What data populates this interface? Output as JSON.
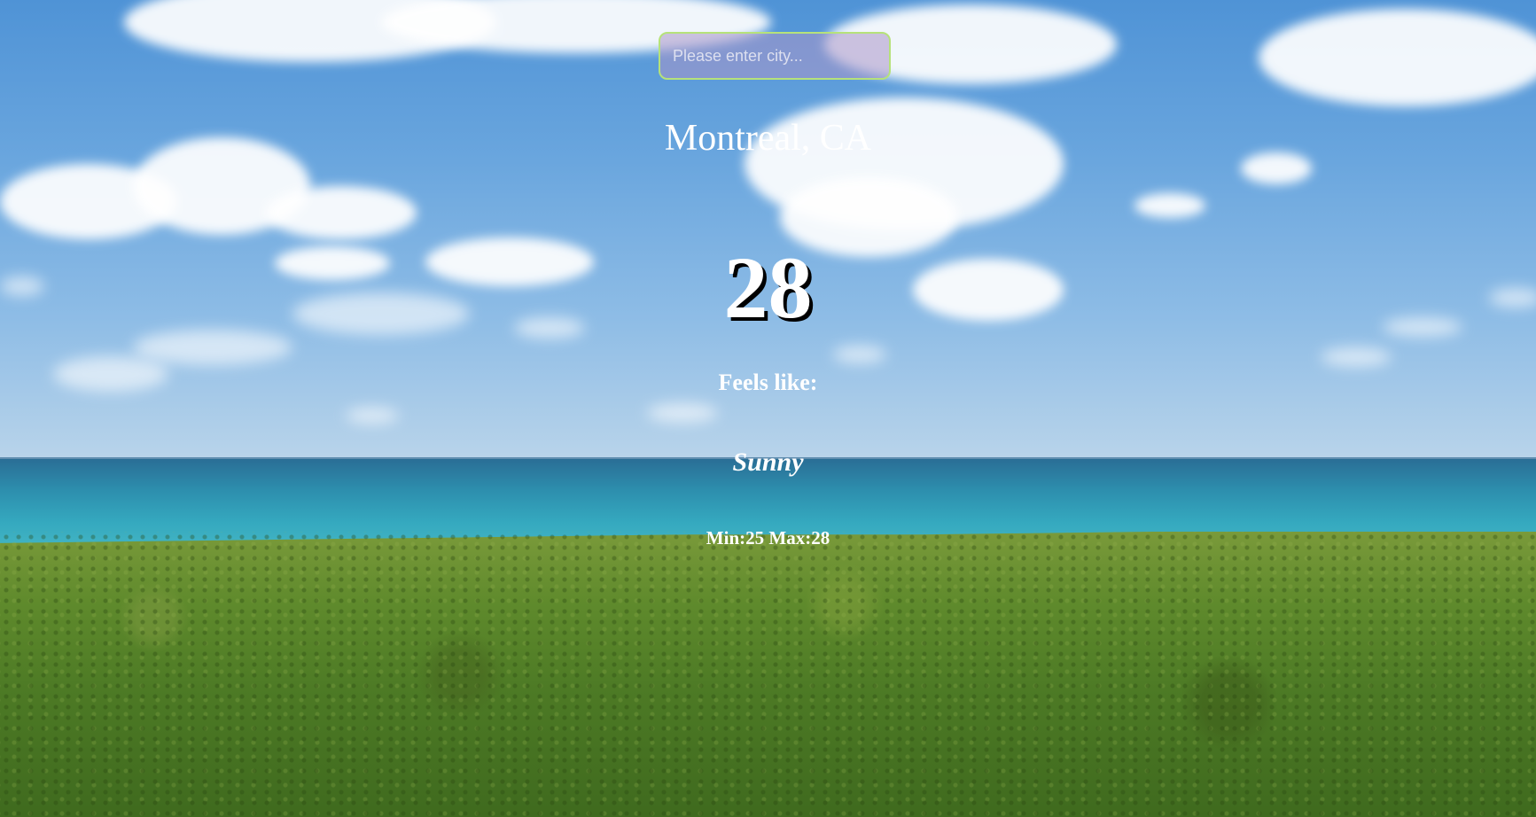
{
  "search": {
    "placeholder": "Please enter city..."
  },
  "weather": {
    "city": "Montreal, CA",
    "temperature": "28",
    "feels_like_label": "Feels like:",
    "condition": "Sunny",
    "min_max": "Min:25 Max:28"
  },
  "colors": {
    "search_border": "#b6e27a",
    "text": "#ffffff",
    "temp_shadow": "#000000"
  }
}
